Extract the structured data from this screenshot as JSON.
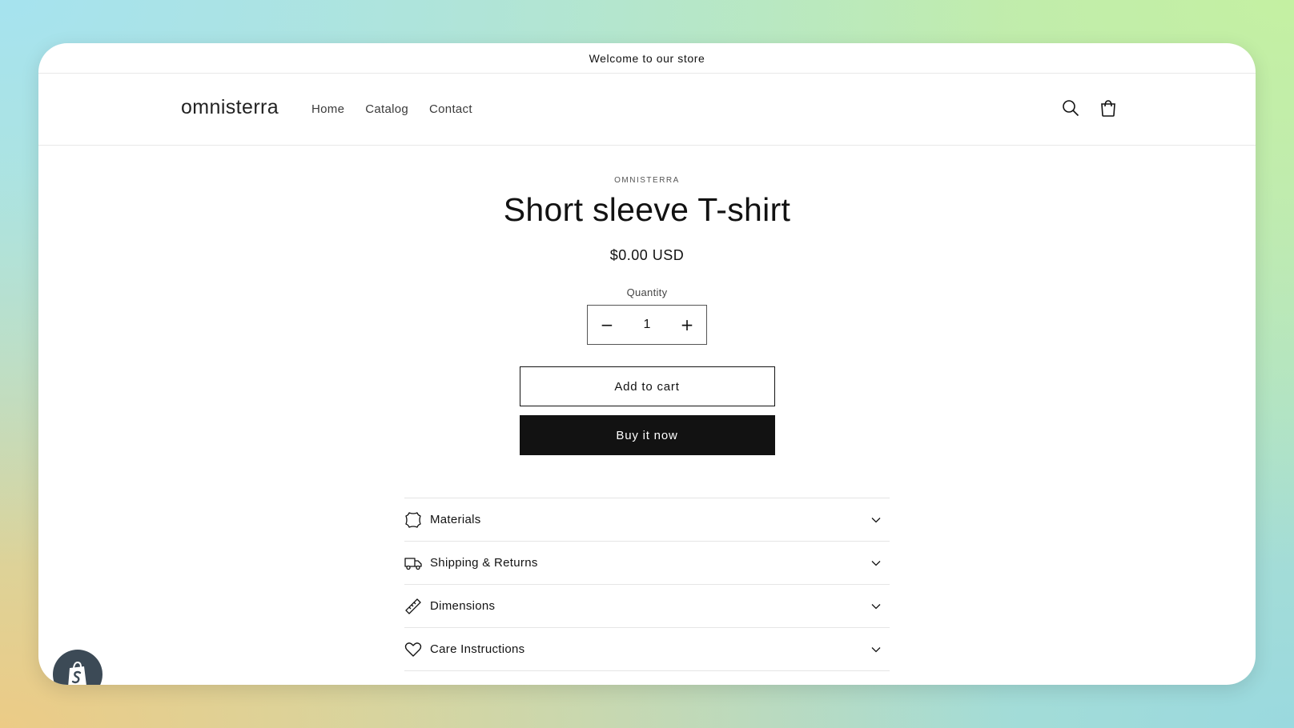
{
  "announcement": {
    "text": "Welcome to our store"
  },
  "header": {
    "logo": "omnisterra",
    "nav": [
      "Home",
      "Catalog",
      "Contact"
    ],
    "icons": {
      "search": "search-icon",
      "cart": "cart-icon"
    }
  },
  "product": {
    "vendor": "OMNISTERRA",
    "title": "Short sleeve T-shirt",
    "price": "$0.00 USD",
    "quantity_label": "Quantity",
    "quantity_value": "1",
    "decrement_glyph": "−",
    "increment_glyph": "+",
    "add_to_cart": "Add to cart",
    "buy_now": "Buy it now"
  },
  "accordion": [
    {
      "label": "Materials",
      "icon": "leather-icon"
    },
    {
      "label": "Shipping & Returns",
      "icon": "truck-icon"
    },
    {
      "label": "Dimensions",
      "icon": "ruler-icon"
    },
    {
      "label": "Care Instructions",
      "icon": "heart-icon"
    }
  ],
  "colors": {
    "text": "#121212",
    "button_dark": "#121212",
    "border": "#e5e5e5",
    "badge": "#3c4a56"
  }
}
